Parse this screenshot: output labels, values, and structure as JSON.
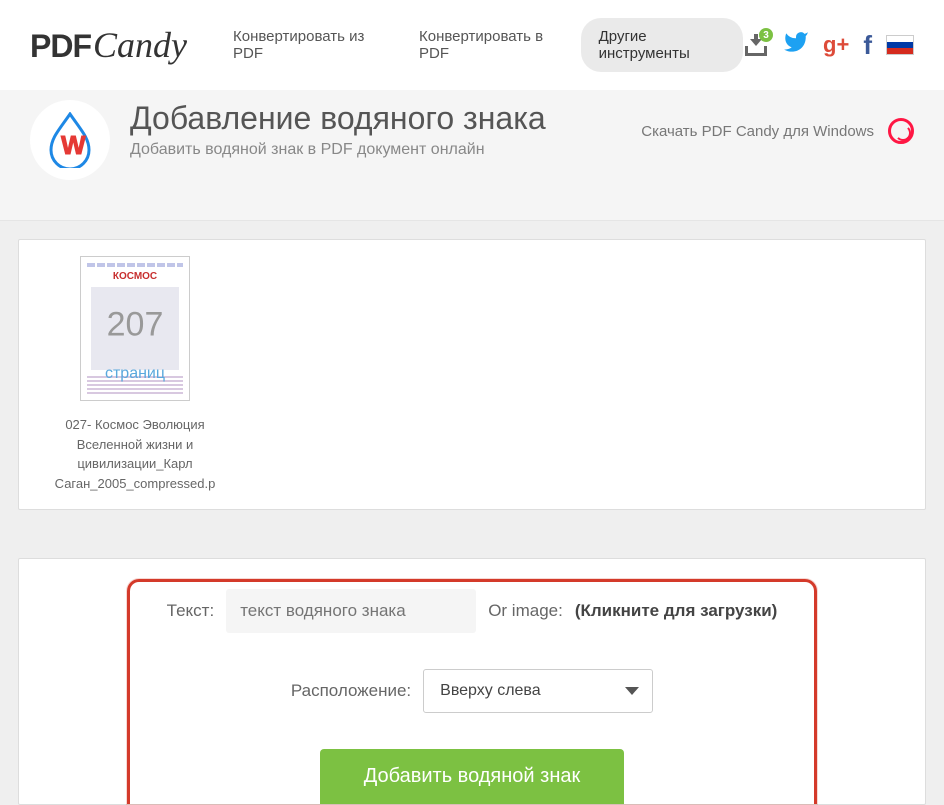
{
  "header": {
    "logo_pdf": "PDF",
    "logo_candy": "Candy",
    "nav": [
      "Конвертировать из PDF",
      "Конвертировать в PDF",
      "Другие инструменты"
    ],
    "active_nav_index": 2,
    "download_badge": "3",
    "social": {
      "gplus": "g+",
      "fb": "f"
    }
  },
  "title": {
    "heading": "Добавление водяного знака",
    "subheading": "Добавить водяной знак в PDF документ онлайн",
    "download_link": "Скачать PDF Candy для Windows"
  },
  "file": {
    "thumb_title": "КОСМОС",
    "page_count": "207",
    "page_label": "страниц",
    "filename": "027- Космос Эволюция Вселенной жизни и цивилизации_Карл Саган_2005_compressed.p"
  },
  "form": {
    "text_label": "Текст:",
    "text_placeholder": "текст водяного знака",
    "or_image_label": "Or image:",
    "click_upload": "(Кликните для загрузки)",
    "position_label": "Расположение:",
    "position_value": "Вверху слева",
    "submit": "Добавить водяной знак"
  }
}
